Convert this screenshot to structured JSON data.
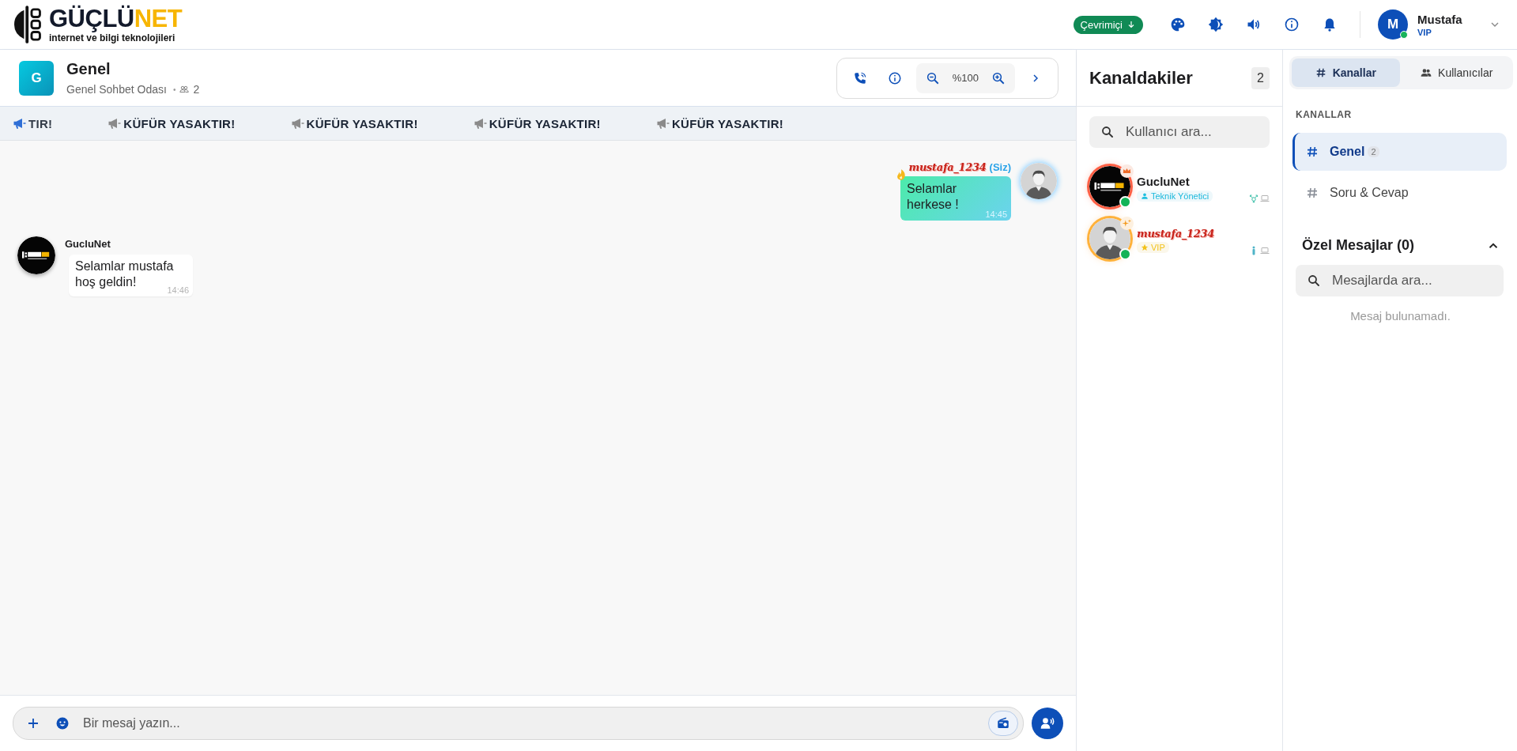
{
  "brand": {
    "name": "GÜÇLÜ",
    "name_accent": "NET",
    "tagline": "internet ve bilgi teknolojileri"
  },
  "topbar": {
    "status": "Çevrimiçi",
    "user": {
      "initial": "M",
      "name": "Mustafa",
      "rank": "VIP",
      "online": true
    }
  },
  "channel": {
    "initial": "G",
    "name": "Genel",
    "subtitle": "Genel Sohbet Odası",
    "separator": "•",
    "member_count": "2",
    "zoom": "%100"
  },
  "ticker": [
    {
      "text": "TIR!",
      "active": true
    },
    {
      "text": "KÜFÜR YASAKTIR!",
      "active": false
    },
    {
      "text": "KÜFÜR YASAKTIR!",
      "active": false
    },
    {
      "text": "KÜFÜR YASAKTIR!",
      "active": false
    },
    {
      "text": "KÜFÜR YASAKTIR!",
      "active": false
    }
  ],
  "messages": [
    {
      "own": true,
      "author": "mustafa_1234",
      "you_tag": "(Siz)",
      "text": "Selamlar herkese !",
      "time": "14:45"
    },
    {
      "own": false,
      "author": "GucluNet",
      "text": "Selamlar mustafa hoş geldin!",
      "time": "14:46"
    }
  ],
  "composer": {
    "placeholder": "Bir mesaj yazın...",
    "radio_active": true
  },
  "members": {
    "title": "Kanaldakiler",
    "count": "2",
    "search_placeholder": "Kullanıcı ara...",
    "list": [
      {
        "name": "GucluNet",
        "role": "Teknik Yönetici",
        "kind": "admin",
        "online": true
      },
      {
        "name": "mustafa_1234",
        "role": "VIP",
        "kind": "vip",
        "online": true
      }
    ]
  },
  "sidebar": {
    "tabs": [
      {
        "label": "Kanallar",
        "selected": true
      },
      {
        "label": "Kullanıcılar",
        "selected": false
      }
    ],
    "section": "KANALLAR",
    "channels": [
      {
        "name": "Genel",
        "count": "2",
        "selected": true
      },
      {
        "name": "Soru & Cevap",
        "selected": false
      }
    ],
    "dm_title": "Özel Mesajlar (0)",
    "dm_expanded": true,
    "dm_search_placeholder": "Mesajlarda ara...",
    "dm_empty": "Mesaj bulunamadı."
  }
}
